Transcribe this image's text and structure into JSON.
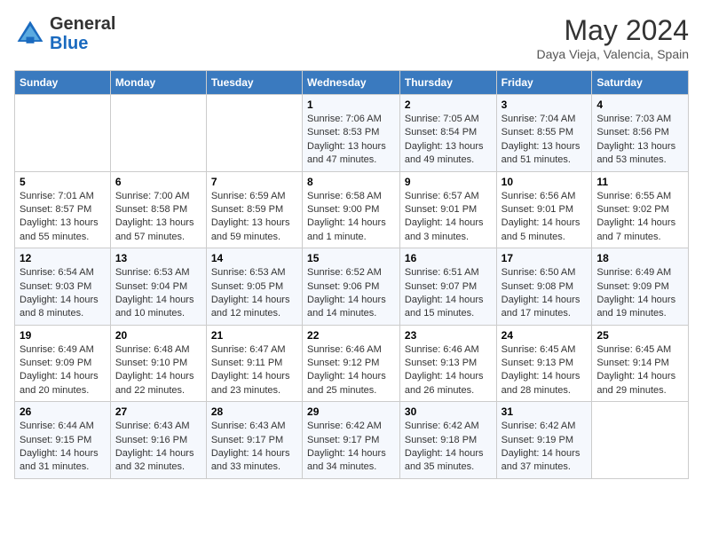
{
  "header": {
    "logo_general": "General",
    "logo_blue": "Blue",
    "month_title": "May 2024",
    "location": "Daya Vieja, Valencia, Spain"
  },
  "days_of_week": [
    "Sunday",
    "Monday",
    "Tuesday",
    "Wednesday",
    "Thursday",
    "Friday",
    "Saturday"
  ],
  "weeks": [
    [
      {
        "day": "",
        "info": ""
      },
      {
        "day": "",
        "info": ""
      },
      {
        "day": "",
        "info": ""
      },
      {
        "day": "1",
        "info": "Sunrise: 7:06 AM\nSunset: 8:53 PM\nDaylight: 13 hours and 47 minutes."
      },
      {
        "day": "2",
        "info": "Sunrise: 7:05 AM\nSunset: 8:54 PM\nDaylight: 13 hours and 49 minutes."
      },
      {
        "day": "3",
        "info": "Sunrise: 7:04 AM\nSunset: 8:55 PM\nDaylight: 13 hours and 51 minutes."
      },
      {
        "day": "4",
        "info": "Sunrise: 7:03 AM\nSunset: 8:56 PM\nDaylight: 13 hours and 53 minutes."
      }
    ],
    [
      {
        "day": "5",
        "info": "Sunrise: 7:01 AM\nSunset: 8:57 PM\nDaylight: 13 hours and 55 minutes."
      },
      {
        "day": "6",
        "info": "Sunrise: 7:00 AM\nSunset: 8:58 PM\nDaylight: 13 hours and 57 minutes."
      },
      {
        "day": "7",
        "info": "Sunrise: 6:59 AM\nSunset: 8:59 PM\nDaylight: 13 hours and 59 minutes."
      },
      {
        "day": "8",
        "info": "Sunrise: 6:58 AM\nSunset: 9:00 PM\nDaylight: 14 hours and 1 minute."
      },
      {
        "day": "9",
        "info": "Sunrise: 6:57 AM\nSunset: 9:01 PM\nDaylight: 14 hours and 3 minutes."
      },
      {
        "day": "10",
        "info": "Sunrise: 6:56 AM\nSunset: 9:01 PM\nDaylight: 14 hours and 5 minutes."
      },
      {
        "day": "11",
        "info": "Sunrise: 6:55 AM\nSunset: 9:02 PM\nDaylight: 14 hours and 7 minutes."
      }
    ],
    [
      {
        "day": "12",
        "info": "Sunrise: 6:54 AM\nSunset: 9:03 PM\nDaylight: 14 hours and 8 minutes."
      },
      {
        "day": "13",
        "info": "Sunrise: 6:53 AM\nSunset: 9:04 PM\nDaylight: 14 hours and 10 minutes."
      },
      {
        "day": "14",
        "info": "Sunrise: 6:53 AM\nSunset: 9:05 PM\nDaylight: 14 hours and 12 minutes."
      },
      {
        "day": "15",
        "info": "Sunrise: 6:52 AM\nSunset: 9:06 PM\nDaylight: 14 hours and 14 minutes."
      },
      {
        "day": "16",
        "info": "Sunrise: 6:51 AM\nSunset: 9:07 PM\nDaylight: 14 hours and 15 minutes."
      },
      {
        "day": "17",
        "info": "Sunrise: 6:50 AM\nSunset: 9:08 PM\nDaylight: 14 hours and 17 minutes."
      },
      {
        "day": "18",
        "info": "Sunrise: 6:49 AM\nSunset: 9:09 PM\nDaylight: 14 hours and 19 minutes."
      }
    ],
    [
      {
        "day": "19",
        "info": "Sunrise: 6:49 AM\nSunset: 9:09 PM\nDaylight: 14 hours and 20 minutes."
      },
      {
        "day": "20",
        "info": "Sunrise: 6:48 AM\nSunset: 9:10 PM\nDaylight: 14 hours and 22 minutes."
      },
      {
        "day": "21",
        "info": "Sunrise: 6:47 AM\nSunset: 9:11 PM\nDaylight: 14 hours and 23 minutes."
      },
      {
        "day": "22",
        "info": "Sunrise: 6:46 AM\nSunset: 9:12 PM\nDaylight: 14 hours and 25 minutes."
      },
      {
        "day": "23",
        "info": "Sunrise: 6:46 AM\nSunset: 9:13 PM\nDaylight: 14 hours and 26 minutes."
      },
      {
        "day": "24",
        "info": "Sunrise: 6:45 AM\nSunset: 9:13 PM\nDaylight: 14 hours and 28 minutes."
      },
      {
        "day": "25",
        "info": "Sunrise: 6:45 AM\nSunset: 9:14 PM\nDaylight: 14 hours and 29 minutes."
      }
    ],
    [
      {
        "day": "26",
        "info": "Sunrise: 6:44 AM\nSunset: 9:15 PM\nDaylight: 14 hours and 31 minutes."
      },
      {
        "day": "27",
        "info": "Sunrise: 6:43 AM\nSunset: 9:16 PM\nDaylight: 14 hours and 32 minutes."
      },
      {
        "day": "28",
        "info": "Sunrise: 6:43 AM\nSunset: 9:17 PM\nDaylight: 14 hours and 33 minutes."
      },
      {
        "day": "29",
        "info": "Sunrise: 6:42 AM\nSunset: 9:17 PM\nDaylight: 14 hours and 34 minutes."
      },
      {
        "day": "30",
        "info": "Sunrise: 6:42 AM\nSunset: 9:18 PM\nDaylight: 14 hours and 35 minutes."
      },
      {
        "day": "31",
        "info": "Sunrise: 6:42 AM\nSunset: 9:19 PM\nDaylight: 14 hours and 37 minutes."
      },
      {
        "day": "",
        "info": ""
      }
    ]
  ]
}
